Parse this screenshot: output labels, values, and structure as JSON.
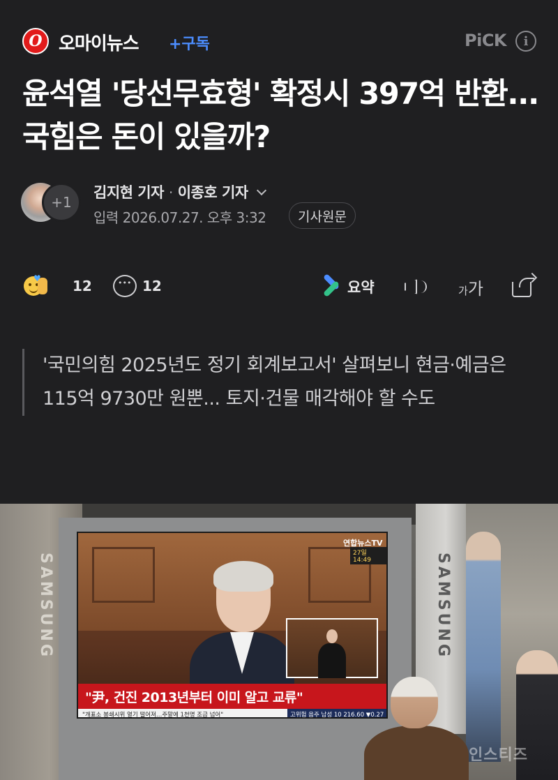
{
  "header": {
    "press_logo_letter": "O",
    "press_name": "오마이뉴스",
    "subscribe_label": "+구독",
    "pick_label": "PiCK",
    "info_symbol": "i"
  },
  "article": {
    "title": "윤석열 '당선무효형' 확정시 397억 반환... 국힘은 돈이 있을까?",
    "reporters": {
      "first": "김지현 기자",
      "separator": "·",
      "second": "이종호 기자",
      "more_count": "+1"
    },
    "date": "입력 2026.07.27. 오후 3:32",
    "original_button": "기사원문",
    "subtitle": "'국민의힘 2025년도 정기 회계보고서' 살펴보니 현금·예금은 115억 9730만 원뿐... 토지·건물 매각해야 할 수도"
  },
  "actions": {
    "reaction_count": "12",
    "comment_count": "12",
    "summary_label": "요약",
    "font_small": "가",
    "font_big": "가"
  },
  "photo": {
    "tv_brand": "SAMSUNG",
    "news_channel": "연합뉴스TV",
    "news_time": "27일 14:49",
    "headline": "\"尹, 건진 2013년부터 이미 알고 교류\"",
    "ticker": "\"개표소 봉쇄시위 열기 떨어져…주말에 1천명 조금 넘어\"",
    "ticker_stock": "고위험 음주 남성 10   216.60 ▼0.27",
    "watermark": "인스티즈"
  },
  "colors": {
    "background": "#1f1f21",
    "accent_blue": "#4c8dff",
    "logo_red": "#e21b1b",
    "headline_red": "#c7161c"
  }
}
